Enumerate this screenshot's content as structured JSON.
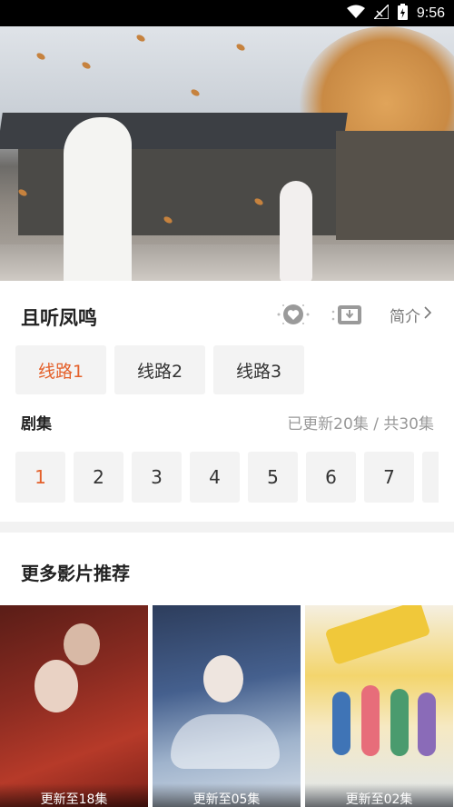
{
  "status_bar": {
    "time": "9:56",
    "icons": [
      "wifi-icon",
      "signal-icon",
      "battery-charging-icon"
    ]
  },
  "show": {
    "title": "且听凤鸣"
  },
  "actions": {
    "favorite_icon": "heart-icon",
    "download_icon": "download-icon",
    "intro_label": "简介"
  },
  "routes": [
    {
      "label": "线路1",
      "active": true
    },
    {
      "label": "线路2",
      "active": false
    },
    {
      "label": "线路3",
      "active": false
    }
  ],
  "episodes_section": {
    "label": "剧集",
    "status": "已更新20集 / 共30集"
  },
  "episodes": [
    "1",
    "2",
    "3",
    "4",
    "5",
    "6",
    "7"
  ],
  "more": {
    "title": "更多影片推荐"
  },
  "recommendations": [
    {
      "caption": "更新至18集"
    },
    {
      "caption": "更新至05集"
    },
    {
      "caption": "更新至02集"
    }
  ],
  "colors": {
    "accent": "#e4602a",
    "chip_bg": "#f3f3f3",
    "muted": "#999999"
  }
}
